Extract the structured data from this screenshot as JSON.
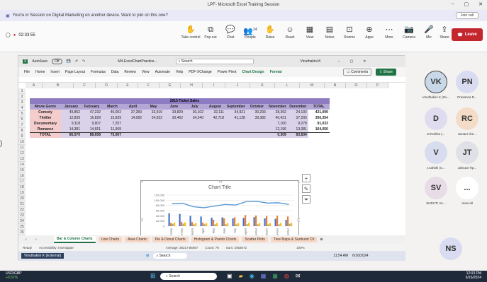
{
  "teams": {
    "window_title": "LPF- Microsoft Excel Training Session",
    "banner_text": "You're in Session on Digital Marketing on another device. Want to join on this one?",
    "join_label": "Join call",
    "timer": "02:33:55",
    "buttons": [
      "Take control",
      "Pop out",
      "Chat",
      "People",
      "Raise",
      "React",
      "View",
      "Notes",
      "Rooms",
      "Apps",
      "More",
      "Camera",
      "Mic",
      "Share"
    ],
    "people_count": "24",
    "leave_label": "Leave"
  },
  "excel": {
    "autosave": "AutoSave",
    "autosave_state": "Off",
    "file_name": "M4-ExcelChartPractice...",
    "search_placeholder": "Search",
    "user": "Vinuthakini K",
    "menu": [
      "File",
      "Home",
      "Insert",
      "Page Layout",
      "Formulas",
      "Data",
      "Review",
      "View",
      "Automate",
      "Help",
      "PDF-XChange",
      "Power Pivot",
      "Chart Design",
      "Format"
    ],
    "active_menu": "Chart Design",
    "comments_label": "Comments",
    "share_label": "Share",
    "columns": [
      "A",
      "B",
      "C",
      "D",
      "E",
      "F",
      "G",
      "H",
      "I",
      "J",
      "K",
      "L",
      "M",
      "N",
      "O",
      "P"
    ],
    "rows": [
      "1",
      "2",
      "3",
      "4",
      "5",
      "6",
      "7",
      "8",
      "9",
      "10",
      "11",
      "12",
      "13",
      "14",
      "15",
      "16",
      "17",
      "18",
      "19",
      "20",
      "21",
      "22",
      "23",
      "24",
      "25",
      "26"
    ],
    "table_title": "2015 Ticket Sales",
    "headers": [
      "Movie Genre",
      "January",
      "February",
      "March",
      "April",
      "May",
      "June",
      "July",
      "August",
      "September",
      "October",
      "November",
      "December",
      "TOTAL"
    ],
    "data": [
      [
        "Comedy",
        "49,852",
        "47,232",
        "40,002",
        "37,283",
        "32,910",
        "33,829",
        "30,102",
        "32,111",
        "34,921",
        "30,293",
        "28,392",
        "24,192",
        "421,099"
      ],
      [
        "Thriller",
        "12,839",
        "16,828",
        "15,839",
        "14,082",
        "24,932",
        "30,462",
        "34,240",
        "42,718",
        "41,128",
        "39,382",
        "40,421",
        "37,293",
        "350,354"
      ],
      [
        "Documentary",
        "9,118",
        "9,907",
        "7,257",
        "",
        "",
        "",
        "",
        "",
        "",
        "",
        "7,100",
        "9,278",
        "91,033"
      ],
      [
        "Romance",
        "14,381",
        "14,651",
        "11,969",
        "",
        "",
        "",
        "",
        "",
        "",
        "",
        "12,196",
        "13,081",
        "164,050"
      ],
      [
        "TOTAL",
        "86,570",
        "88,658",
        "75,067",
        "",
        "",
        "",
        "",
        "",
        "",
        "",
        "0,309",
        "83,834",
        ""
      ]
    ],
    "sheet_tabs": [
      "Bar & Column Charts",
      "Line Charts",
      "Area Charts",
      "Pie & Donut Charts",
      "Histogram & Pareto Charts",
      "Scatter Plots",
      "Tree Maps & Sunburst Ch"
    ],
    "active_tab": "Bar & Column Charts",
    "status_ready": "Ready",
    "status_access": "Accessibility: Investigate",
    "status_average": "Average: 36217.86667",
    "status_count": "Count: 78",
    "status_sum": "Sum: 2053072",
    "status_zoom": "100%",
    "inner_taskbar_user": "Vinuthakini K (External)",
    "inner_search": "Search",
    "inner_time": "11:54 AM",
    "inner_date": "6/16/2024"
  },
  "chart_data": {
    "type": "bar",
    "title": "Chart Title",
    "subtitle": "2015 Ticket Sales",
    "categories": [
      "January",
      "February",
      "March",
      "April",
      "May",
      "June",
      "July",
      "August",
      "September",
      "October",
      "November",
      "December"
    ],
    "series": [
      {
        "name": "Comedy",
        "values": [
          49852,
          47232,
          40002,
          37283,
          32910,
          33829,
          30102,
          32111,
          34921,
          30293,
          28392,
          24192
        ],
        "color": "#4472c4"
      },
      {
        "name": "Thriller",
        "values": [
          12839,
          16828,
          15839,
          14082,
          24932,
          30462,
          34240,
          42718,
          41128,
          39382,
          40421,
          37293
        ],
        "color": "#ed7d31"
      },
      {
        "name": "Documentary",
        "values": [
          9118,
          9907,
          7257,
          7500,
          7200,
          7400,
          7000,
          7600,
          7300,
          7100,
          7100,
          9278
        ],
        "color": "#a5a5a5"
      },
      {
        "name": "Romance",
        "values": [
          14381,
          14651,
          11969,
          12000,
          12500,
          12100,
          12300,
          12600,
          12400,
          12200,
          12196,
          13081
        ],
        "color": "#ffc000"
      }
    ],
    "line_series": {
      "name": "TOTAL",
      "values": [
        86570,
        88658,
        75067,
        71000,
        77500,
        83700,
        81600,
        95000,
        95700,
        89000,
        90309,
        83834
      ],
      "color": "#5b9bd5"
    },
    "yticks": [
      "120,000",
      "100,000",
      "80,000",
      "60,000",
      "40,000",
      "20,000",
      "0"
    ],
    "ylim": [
      0,
      120000
    ]
  },
  "participants": [
    {
      "initials": "VK",
      "name": "Vinuthakini K (Gu...",
      "color": "#c8d8e8"
    },
    {
      "initials": "PN",
      "name": "Prasanna N...",
      "color": "#d9dbf0"
    },
    {
      "initials": "D",
      "name": "D.Rohika (...",
      "color": "#e0dcf0"
    },
    {
      "initials": "RC",
      "name": "ramani che...",
      "color": "#f3dcc8"
    },
    {
      "initials": "V",
      "name": "v.sahithi (U...",
      "color": "#d7dcee"
    },
    {
      "initials": "JT",
      "name": "Jahnavi Tip...",
      "color": "#dfe1e6"
    },
    {
      "initials": "SV",
      "name": "SHRUTI VA...",
      "color": "#e8dde6"
    },
    {
      "initials": "...",
      "name": "View all",
      "color": "#ffffff"
    },
    {
      "initials": "NS",
      "name": "",
      "color": "#d9dbf0"
    }
  ],
  "taskbar": {
    "ticker": "USD/GBP",
    "ticker_change": "+0.57%",
    "search": "Search",
    "time": "12:03 PM",
    "date": "6/16/2024"
  }
}
